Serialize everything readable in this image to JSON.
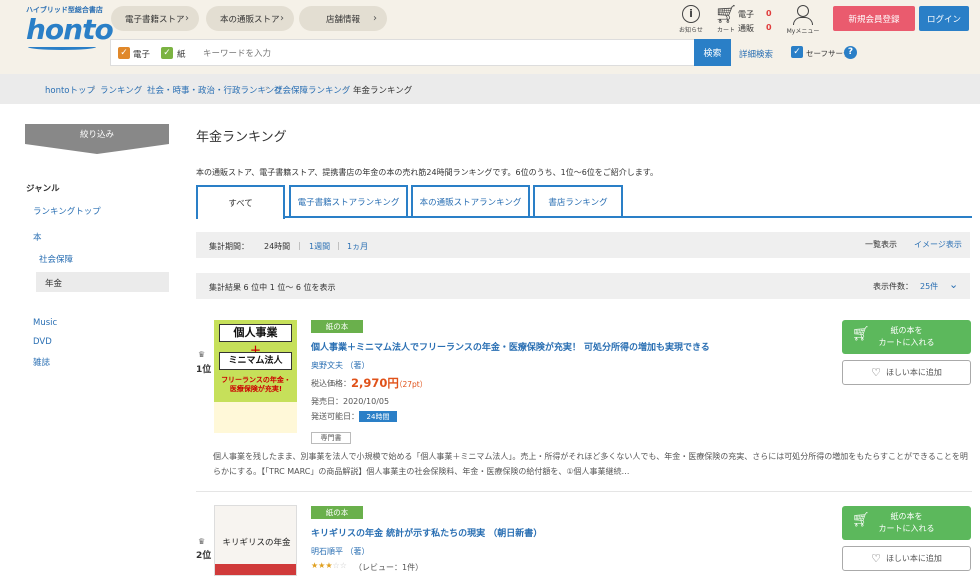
{
  "header": {
    "logo_tagline": "ハイブリッド型総合書店",
    "logo_text": "honto",
    "nav": [
      "電子書籍ストア",
      "本の通販ストア",
      "店舗情報"
    ],
    "search_checkbox_ebook": "電子",
    "search_checkbox_paper": "紙",
    "search_placeholder": "キーワードを入力",
    "search_button": "検索",
    "advanced_search": "詳細検索",
    "safe_search": "セーフサーチ",
    "notice_label": "お知らせ",
    "cart_label": "カート",
    "cart_ebook_label": "電子",
    "cart_ebook_count": "0",
    "cart_paper_label": "通販",
    "cart_paper_count": "0",
    "mymenu_label": "Myメニュー",
    "register_button": "新規会員登録",
    "login_button": "ログイン"
  },
  "breadcrumb": [
    "hontoトップ",
    "ランキング",
    "社会・時事・政治・行政ランキング",
    "社会保障ランキング",
    "年金ランキング"
  ],
  "sidebar": {
    "filter_label": "絞り込み",
    "genre_heading": "ジャンル",
    "items": [
      "ランキングトップ",
      "本",
      "社会保障",
      "年金",
      "Music",
      "DVD",
      "雑誌"
    ]
  },
  "main": {
    "title": "年金ランキング",
    "description": "本の通販ストア、電子書籍ストア、提携書店の年金の本の売れ筋24時間ランキングです。6位のうち、1位～6位をご紹介します。",
    "tabs": [
      "すべて",
      "電子書籍ストアランキング",
      "本の通販ストアランキング",
      "書店ランキング"
    ],
    "period_label": "集計期間：",
    "period_options": [
      "24時間",
      "1週間",
      "1ヵ月"
    ],
    "view_list": "一覧表示",
    "view_image": "イメージ表示",
    "result_summary": "集計結果 6 位中 1 位～ 6 位を表示",
    "per_page_label": "表示件数：",
    "per_page_value": "25件"
  },
  "items": [
    {
      "rank": "1位",
      "badge": "紙の本",
      "title": "個人事業＋ミニマム法人でフリーランスの年金・医療保険が充実！ 可処分所得の増加も実現できる",
      "author": "奥野文夫 （著）",
      "price_label": "税込価格：",
      "price": "2,970円",
      "points": "（27pt）",
      "release": "発売日：2020/10/05",
      "ship_label": "発送可能日：",
      "ship_tag": "24時間",
      "chip": "専門書",
      "synopsis": "個人事業を残したまま、別事業を法人で小規模で始める「個人事業＋ミニマム法人」。売上・所得がそれほど多くない人でも、年金・医療保険の充実、さらには可処分所得の増加をもたらすことができることを明らかにする。【「TRC MARC」の商品解説】個人事業主の社会保険料、年金・医療保険の給付額を、①個人事業継続…",
      "cover_title1": "個人事業",
      "cover_title2": "ミニマム法人",
      "cover_sub": "フリーランスの年金・医療保険が充実!",
      "cart_button": "紙の本を\nカートに入れる",
      "wish_button": "ほしい本に追加"
    },
    {
      "rank": "2位",
      "badge": "紙の本",
      "title": "キリギリスの年金 統計が示す私たちの現実 （朝日新書）",
      "author": "明石順平 （著）",
      "review": "（レビュー：1件）",
      "cover_title1": "キリギリスの年金",
      "cart_button": "紙の本を\nカートに入れる",
      "wish_button": "ほしい本に追加"
    }
  ],
  "colors": {
    "brand": "#2a7fc7",
    "register": "#ea5b6e",
    "cart": "#5cb85c",
    "price": "#e0521a",
    "badge": "#6ab04c"
  }
}
